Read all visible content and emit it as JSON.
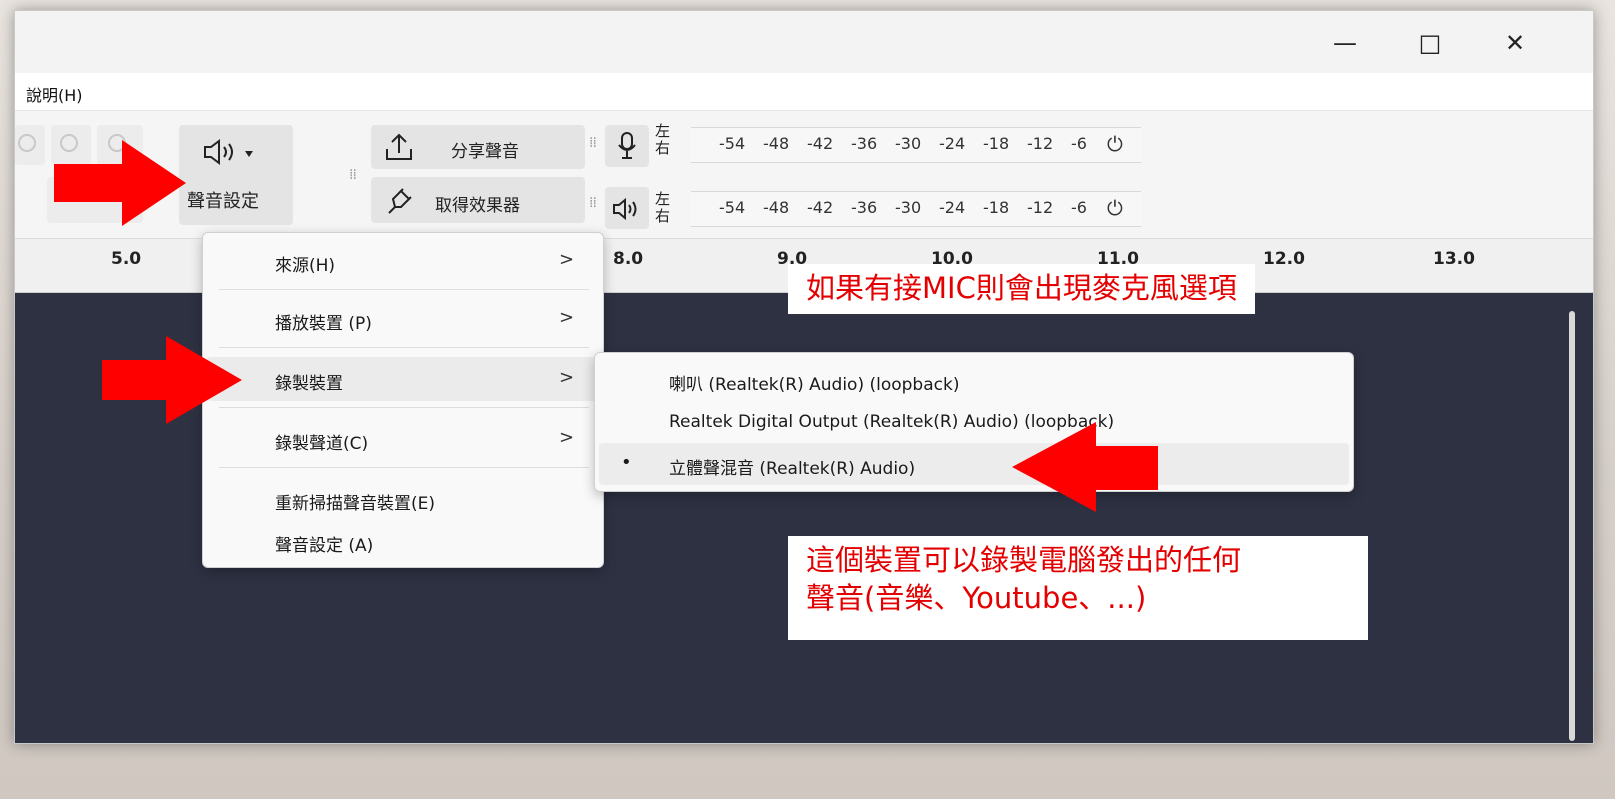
{
  "window": {
    "minimize_glyph": "—",
    "maximize_glyph": "□",
    "close_glyph": "✕"
  },
  "menubar": {
    "help_label": "說明(H)"
  },
  "toolbar": {
    "audio_setup_icon": "speaker-icon",
    "audio_setup_label": "聲音設定",
    "share_audio_label": "分享聲音",
    "get_effects_label": "取得效果器",
    "meter_lr_top": "左",
    "meter_lr_bottom": "右",
    "record_meter_ticks": [
      "-54",
      "-48",
      "-42",
      "-36",
      "-30",
      "-24",
      "-18",
      "-12",
      "-6"
    ],
    "play_meter_ticks": [
      "-54",
      "-48",
      "-42",
      "-36",
      "-30",
      "-24",
      "-18",
      "-12",
      "-6"
    ]
  },
  "timeline": {
    "ticks": [
      "5.0",
      "8.0",
      "9.0",
      "10.0",
      "11.0",
      "12.0",
      "13.0"
    ]
  },
  "dropdown": {
    "items": [
      {
        "label": "來源(H)",
        "has_submenu": true
      },
      {
        "label": "播放裝置 (P)",
        "has_submenu": true
      },
      {
        "label": "錄製裝置",
        "has_submenu": true
      },
      {
        "label": "錄製聲道(C)",
        "has_submenu": true
      },
      {
        "label": "重新掃描聲音裝置(E)",
        "has_submenu": false
      },
      {
        "label": "聲音設定 (A)",
        "has_submenu": false
      }
    ],
    "chevron": ">"
  },
  "submenu": {
    "items": [
      {
        "label": "喇叭 (Realtek(R) Audio) (loopback)",
        "selected": false
      },
      {
        "label": "Realtek Digital Output (Realtek(R) Audio) (loopback)",
        "selected": false
      },
      {
        "label": "立體聲混音 (Realtek(R) Audio)",
        "selected": true
      }
    ],
    "selected_bullet": "•"
  },
  "annotations": {
    "mic_note": "如果有接MIC則會出現麥克風選項",
    "device_note_line1": "這個裝置可以錄製電腦發出的任何",
    "device_note_line2": "聲音(音樂、Youtube、...)"
  },
  "colors": {
    "annotation_red": "#ff0000",
    "track_bg": "#2d3142"
  }
}
